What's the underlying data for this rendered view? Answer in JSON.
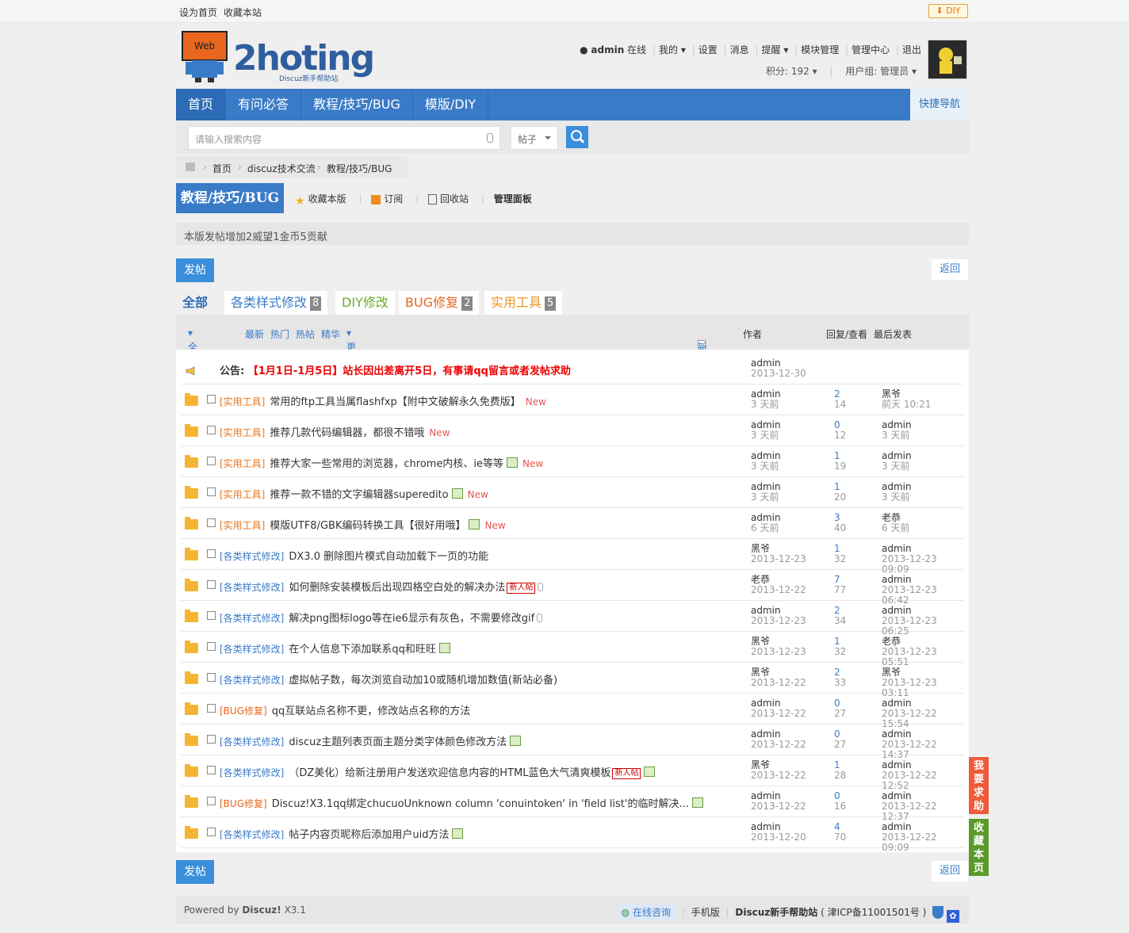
{
  "topbar": {
    "set_home": "设为首页",
    "bookmark": "收藏本站",
    "diy": "DIY"
  },
  "logo": {
    "text": "2hoting",
    "sub": "Discuz新手帮助站",
    "badge": "Web"
  },
  "user": {
    "name": "admin",
    "status": "在线",
    "menu": [
      "我的",
      "设置",
      "消息",
      "提醒",
      "模块管理",
      "管理中心",
      "退出"
    ],
    "credits_label": "积分: 192",
    "group_label": "用户组: 管理员"
  },
  "nav": {
    "items": [
      "首页",
      "有问必答",
      "教程/技巧/BUG",
      "模版/DIY"
    ],
    "quick": "快捷导航"
  },
  "search": {
    "placeholder": "请输入搜索内容",
    "type": "帖子"
  },
  "breadcrumb": [
    "首页",
    "discuz技术交流",
    "教程/技巧/BUG"
  ],
  "forum": {
    "title": "教程/技巧/BUG",
    "actions": [
      "收藏本版",
      "订阅",
      "回收站",
      "管理面板"
    ],
    "rules": "本版发帖增加2威望1金币5贡献"
  },
  "buttons": {
    "post": "发帖",
    "back": "返回"
  },
  "tabs": [
    {
      "label": "全部",
      "count": "",
      "color": "#2f6db5"
    },
    {
      "label": "各类样式修改",
      "count": "8",
      "color": "#3a7bc8"
    },
    {
      "label": "DIY修改",
      "count": "",
      "color": "#6bab2a"
    },
    {
      "label": "BUG修复",
      "count": "2",
      "color": "#e8661e"
    },
    {
      "label": "实用工具",
      "count": "5",
      "color": "#e8961e"
    }
  ],
  "filters": {
    "all": "全部主题",
    "items": [
      "最新",
      "热门",
      "热帖",
      "精华",
      "更多"
    ],
    "newwin": "新窗",
    "author": "作者",
    "replies": "回复/查看",
    "last": "最后发表"
  },
  "announcement": {
    "prefix": "公告:",
    "text": "【1月1日-1月5日】站长因出差离开5日，有事请qq留言或者发帖求助",
    "author": "admin",
    "date": "2013-12-30"
  },
  "threads": [
    {
      "type": "[实用工具]",
      "type_color": "#e8761e",
      "title": "常用的ftp工具当属flashfxp【附中文破解永久免费版】",
      "img": false,
      "clip": false,
      "xin": false,
      "new": "New",
      "author": "admin",
      "date": "3 天前",
      "replies": "2",
      "views": "14",
      "last_user": "黑爷",
      "last_time": "前天 10:21"
    },
    {
      "type": "[实用工具]",
      "type_color": "#e8761e",
      "title": "推荐几款代码编辑器，都很不错哦",
      "img": false,
      "clip": false,
      "xin": false,
      "new": "New",
      "author": "admin",
      "date": "3 天前",
      "replies": "0",
      "views": "12",
      "last_user": "admin",
      "last_time": "3 天前"
    },
    {
      "type": "[实用工具]",
      "type_color": "#e8761e",
      "title": "推荐大家一些常用的浏览器，chrome内核、ie等等",
      "img": true,
      "clip": false,
      "xin": false,
      "new": "New",
      "author": "admin",
      "date": "3 天前",
      "replies": "1",
      "views": "19",
      "last_user": "admin",
      "last_time": "3 天前"
    },
    {
      "type": "[实用工具]",
      "type_color": "#e8761e",
      "title": "推荐一款不错的文字编辑器superedito",
      "img": true,
      "clip": false,
      "xin": false,
      "new": "New",
      "author": "admin",
      "date": "3 天前",
      "replies": "1",
      "views": "20",
      "last_user": "admin",
      "last_time": "3 天前"
    },
    {
      "type": "[实用工具]",
      "type_color": "#e8761e",
      "title": "模版UTF8/GBK编码转换工具【很好用哦】",
      "img": true,
      "clip": false,
      "xin": false,
      "new": "New",
      "author": "admin",
      "date": "6 天前",
      "replies": "3",
      "views": "40",
      "last_user": "老恭",
      "last_time": "6 天前"
    },
    {
      "type": "[各类样式修改]",
      "type_color": "#3a7bc8",
      "title": "DX3.0 删除图片模式自动加载下一页的功能",
      "img": false,
      "clip": false,
      "xin": false,
      "new": "",
      "author": "黑爷",
      "date": "2013-12-23",
      "replies": "1",
      "views": "32",
      "last_user": "admin",
      "last_time": "2013-12-23 09:09"
    },
    {
      "type": "[各类样式修改]",
      "type_color": "#3a7bc8",
      "title": "如何删除安装模板后出现四格空白处的解决办法",
      "img": false,
      "clip": true,
      "xin": true,
      "new": "",
      "author": "老恭",
      "date": "2013-12-22",
      "replies": "7",
      "views": "77",
      "last_user": "admin",
      "last_time": "2013-12-23 06:42"
    },
    {
      "type": "[各类样式修改]",
      "type_color": "#3a7bc8",
      "title": "解决png图标logo等在ie6显示有灰色，不需要修改gif",
      "img": false,
      "clip": true,
      "xin": false,
      "new": "",
      "author": "admin",
      "date": "2013-12-23",
      "replies": "2",
      "views": "34",
      "last_user": "admin",
      "last_time": "2013-12-23 06:25"
    },
    {
      "type": "[各类样式修改]",
      "type_color": "#3a7bc8",
      "title": "在个人信息下添加联系qq和旺旺",
      "img": true,
      "clip": false,
      "xin": false,
      "new": "",
      "author": "黑爷",
      "date": "2013-12-23",
      "replies": "1",
      "views": "32",
      "last_user": "老恭",
      "last_time": "2013-12-23 05:51"
    },
    {
      "type": "[各类样式修改]",
      "type_color": "#3a7bc8",
      "title": "虚拟帖子数，每次浏览自动加10或随机增加数值(新站必备)",
      "img": false,
      "clip": false,
      "xin": false,
      "new": "",
      "author": "黑爷",
      "date": "2013-12-22",
      "replies": "2",
      "views": "33",
      "last_user": "黑爷",
      "last_time": "2013-12-23 03:11"
    },
    {
      "type": "[BUG修复]",
      "type_color": "#e8661e",
      "title": "qq互联站点名称不更，修改站点名称的方法",
      "img": false,
      "clip": false,
      "xin": false,
      "new": "",
      "author": "admin",
      "date": "2013-12-22",
      "replies": "0",
      "views": "27",
      "last_user": "admin",
      "last_time": "2013-12-22 15:54"
    },
    {
      "type": "[各类样式修改]",
      "type_color": "#3a7bc8",
      "title": "discuz主题列表页面主题分类字体颜色修改方法",
      "img": true,
      "clip": false,
      "xin": false,
      "new": "",
      "author": "admin",
      "date": "2013-12-22",
      "replies": "0",
      "views": "27",
      "last_user": "admin",
      "last_time": "2013-12-22 14:37"
    },
    {
      "type": "[各类样式修改]",
      "type_color": "#3a7bc8",
      "title": "（DZ美化）给新注册用户发送欢迎信息内容的HTML蓝色大气清爽模板",
      "img": true,
      "clip": false,
      "xin": true,
      "new": "",
      "author": "黑爷",
      "date": "2013-12-22",
      "replies": "1",
      "views": "28",
      "last_user": "admin",
      "last_time": "2013-12-22 12:52"
    },
    {
      "type": "[BUG修复]",
      "type_color": "#e8661e",
      "title": "Discuz!X3.1qq绑定chucuoUnknown column 'conuintoken' in 'field list'的临时解决...",
      "img": true,
      "clip": false,
      "xin": false,
      "new": "",
      "author": "admin",
      "date": "2013-12-22",
      "replies": "0",
      "views": "16",
      "last_user": "admin",
      "last_time": "2013-12-22 12:37"
    },
    {
      "type": "[各类样式修改]",
      "type_color": "#3a7bc8",
      "title": "帖子内容页昵称后添加用户uid方法",
      "img": true,
      "clip": false,
      "xin": false,
      "new": "",
      "author": "admin",
      "date": "2013-12-20",
      "replies": "4",
      "views": "70",
      "last_user": "admin",
      "last_time": "2013-12-22 09:09"
    }
  ],
  "xin_label": "新人帖",
  "footer": {
    "powered": "Powered by",
    "brand": "Discuz!",
    "version": "X3.1",
    "online": "在线咨询",
    "mobile": "手机版",
    "site": "Discuz新手帮助站",
    "icp": "( 津ICP备11001501号 )"
  },
  "side": {
    "help": "我要求助",
    "fav": "收藏本页"
  }
}
